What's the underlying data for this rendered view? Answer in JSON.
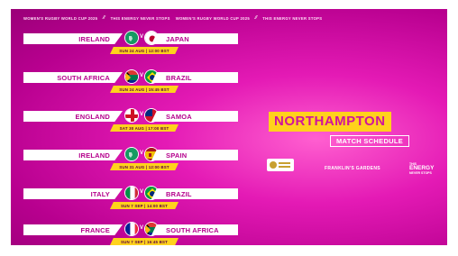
{
  "ticker": [
    "WOMEN'S RUGBY WORLD CUP 2025",
    "THIS ENERGY NEVER STOPS",
    "WOMEN'S RUGBY WORLD CUP 2025",
    "THIS ENERGY NEVER STOPS"
  ],
  "ticker_separator": "⁄⁄",
  "vs_label": "V",
  "matches": [
    {
      "home": "IRELAND",
      "away": "JAPAN",
      "date": "SUN 24 AUG | 12:00 BST",
      "home_flag": "ireland-flag-icon",
      "away_flag": "japan-flag-icon"
    },
    {
      "home": "SOUTH AFRICA",
      "away": "BRAZIL",
      "date": "SUN 24 AUG | 15:45 BST",
      "home_flag": "south-africa-flag-icon",
      "away_flag": "brazil-flag-icon"
    },
    {
      "home": "ENGLAND",
      "away": "SAMOA",
      "date": "SAT 30 AUG | 17:00 BST",
      "home_flag": "england-flag-icon",
      "away_flag": "samoa-flag-icon"
    },
    {
      "home": "IRELAND",
      "away": "SPAIN",
      "date": "SUN 31 AUG | 12:00 BST",
      "home_flag": "ireland-flag-icon",
      "away_flag": "spain-flag-icon"
    },
    {
      "home": "ITALY",
      "away": "BRAZIL",
      "date": "SUN 7 SEP | 14:00 BST",
      "home_flag": "italy-flag-icon",
      "away_flag": "brazil-flag-icon"
    },
    {
      "home": "FRANCE",
      "away": "SOUTH AFRICA",
      "date": "SUN 7 SEP | 16:45 BST",
      "home_flag": "france-flag-icon",
      "away_flag": "south-africa-flag-icon"
    }
  ],
  "title": "NORTHAMPTON",
  "subtitle": "MATCH SCHEDULE",
  "venue": "FRANKLIN'S GARDENS",
  "logo_right_small": "THIS",
  "logo_right_big": "ENERGY",
  "logo_right_tail": "NEVER STOPS",
  "colors": {
    "accent": "#ffd21c",
    "team_text": "#b5008c",
    "background": "#e41ab5"
  }
}
